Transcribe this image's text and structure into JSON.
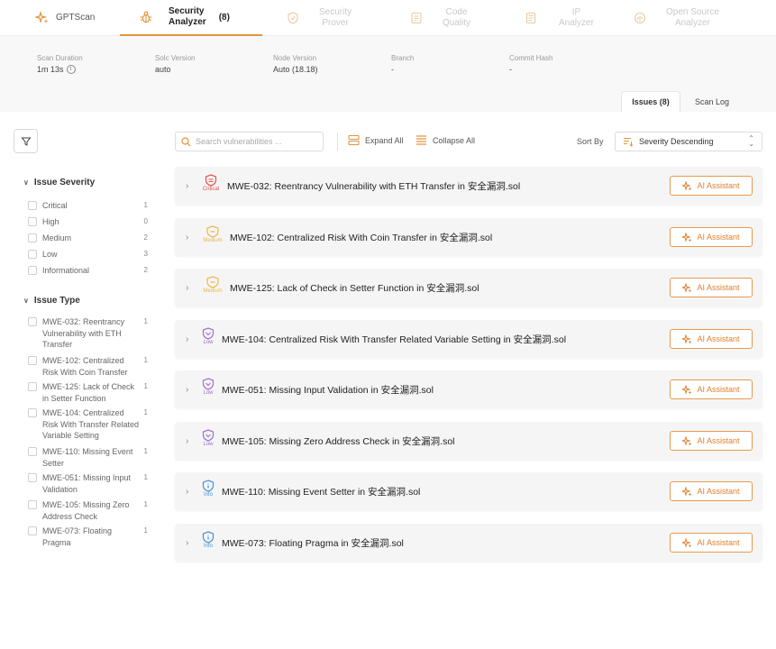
{
  "top_tabs": [
    {
      "label": "GPTScan",
      "icon": "sparkle-icon",
      "state": "plain"
    },
    {
      "label": "Security\nAnalyzer",
      "count": "(8)",
      "icon": "bug-icon",
      "state": "active"
    },
    {
      "label": "Security\nProver",
      "icon": "shield-icon",
      "state": "disabled"
    },
    {
      "label": "Code\nQuality",
      "icon": "code-file-icon",
      "state": "disabled"
    },
    {
      "label": "IP\nAnalyzer",
      "icon": "document-icon",
      "state": "disabled"
    },
    {
      "label": "Open Source\nAnalyzer",
      "icon": "fingerprint-icon",
      "state": "disabled"
    }
  ],
  "scan_info": [
    {
      "label": "Scan Duration",
      "value": "1m 13s"
    },
    {
      "label": "Solc Version",
      "value": "auto"
    },
    {
      "label": "Node Version",
      "value": "Auto (18.18)"
    },
    {
      "label": "Branch",
      "value": "-"
    },
    {
      "label": "Commit Hash",
      "value": "-"
    }
  ],
  "sub_tabs": {
    "issues": "Issues (8)",
    "scan_log": "Scan Log"
  },
  "toolbar": {
    "search_placeholder": "Search vulnerabilities ...",
    "expand_all": "Expand All",
    "collapse_all": "Collapse All",
    "sort_by": "Sort By",
    "sort_value": "Severity Descending"
  },
  "sidebar": {
    "severity_heading": "Issue Severity",
    "severity": [
      {
        "label": "Critical",
        "count": "1"
      },
      {
        "label": "High",
        "count": "0"
      },
      {
        "label": "Medium",
        "count": "2"
      },
      {
        "label": "Low",
        "count": "3"
      },
      {
        "label": "Informational",
        "count": "2"
      }
    ],
    "type_heading": "Issue Type",
    "types": [
      {
        "label": "MWE-032: Reentrancy Vulnerability with ETH Transfer",
        "count": "1"
      },
      {
        "label": "MWE-102: Centralized Risk With Coin Transfer",
        "count": "1"
      },
      {
        "label": "MWE-125: Lack of Check in Setter Function",
        "count": "1"
      },
      {
        "label": "MWE-104: Centralized Risk With Transfer Related Variable Setting",
        "count": "1"
      },
      {
        "label": "MWE-110: Missing Event Setter",
        "count": "1"
      },
      {
        "label": "MWE-051: Missing Input Validation",
        "count": "1"
      },
      {
        "label": "MWE-105: Missing Zero Address Check",
        "count": "1"
      },
      {
        "label": "MWE-073: Floating Pragma",
        "count": "1"
      }
    ]
  },
  "ai_label": "AI Assistant",
  "colors": {
    "accent": "#e3953e",
    "critical": "#e0524a",
    "medium": "#eab94a",
    "low": "#9a6fd6",
    "info": "#4a90d9"
  },
  "issues": [
    {
      "severity": "Critical",
      "title": "MWE-032: Reentrancy Vulnerability with ETH Transfer in 安全漏洞.sol"
    },
    {
      "severity": "Medium",
      "title": "MWE-102: Centralized Risk With Coin Transfer in 安全漏洞.sol"
    },
    {
      "severity": "Medium",
      "title": "MWE-125: Lack of Check in Setter Function in 安全漏洞.sol"
    },
    {
      "severity": "Low",
      "title": "MWE-104: Centralized Risk With Transfer Related Variable Setting in 安全漏洞.sol"
    },
    {
      "severity": "Low",
      "title": "MWE-051: Missing Input Validation in 安全漏洞.sol"
    },
    {
      "severity": "Low",
      "title": "MWE-105: Missing Zero Address Check in 安全漏洞.sol"
    },
    {
      "severity": "Info",
      "title": "MWE-110: Missing Event Setter in 安全漏洞.sol"
    },
    {
      "severity": "Info",
      "title": "MWE-073: Floating Pragma in 安全漏洞.sol"
    }
  ]
}
